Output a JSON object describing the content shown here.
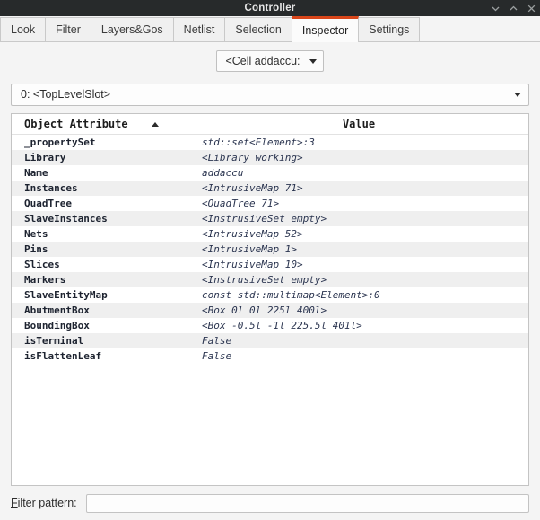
{
  "window": {
    "title": "Controller",
    "buttons": [
      {
        "name": "minimize",
        "icon": "chevron-down-icon"
      },
      {
        "name": "maximize",
        "icon": "chevron-up-icon"
      },
      {
        "name": "close",
        "icon": "close-icon"
      }
    ]
  },
  "colors": {
    "titlebar_bg": "#272a2b",
    "accent_orange": "#d9461a",
    "panel_bg": "#f4f4f4",
    "row_alt_bg": "#efefef",
    "table_bg": "#ffffff"
  },
  "tabs": [
    {
      "label": "Look",
      "active": false
    },
    {
      "label": "Filter",
      "active": false
    },
    {
      "label": "Layers&Gos",
      "active": false
    },
    {
      "label": "Netlist",
      "active": false
    },
    {
      "label": "Selection",
      "active": false
    },
    {
      "label": "Inspector",
      "active": true
    },
    {
      "label": "Settings",
      "active": false
    }
  ],
  "cell_selector": {
    "value": "<Cell addaccu:",
    "icon": "chevron-down-icon"
  },
  "slot_selector": {
    "value": "0: <TopLevelSlot>",
    "icon": "chevron-down-icon"
  },
  "table": {
    "columns": [
      "Object Attribute",
      "Value"
    ],
    "sort": {
      "column": "Object Attribute",
      "direction": "ascending",
      "icon": "sort-ascending-icon"
    },
    "rows": [
      {
        "attribute": "_propertySet",
        "value": "std::set<Element>:3"
      },
      {
        "attribute": "Library",
        "value": "<Library working>"
      },
      {
        "attribute": "Name",
        "value": "addaccu"
      },
      {
        "attribute": "Instances",
        "value": "<IntrusiveMap 71>"
      },
      {
        "attribute": "QuadTree",
        "value": "<QuadTree 71>"
      },
      {
        "attribute": "SlaveInstances",
        "value": "<InstrusiveSet empty>"
      },
      {
        "attribute": "Nets",
        "value": "<IntrusiveMap 52>"
      },
      {
        "attribute": "Pins",
        "value": "<IntrusiveMap 1>"
      },
      {
        "attribute": "Slices",
        "value": "<IntrusiveMap 10>"
      },
      {
        "attribute": "Markers",
        "value": "<InstrusiveSet empty>"
      },
      {
        "attribute": "SlaveEntityMap",
        "value": "const std::multimap<Element>:0"
      },
      {
        "attribute": "AbutmentBox",
        "value": "<Box 0l 0l 225l 400l>"
      },
      {
        "attribute": "BoundingBox",
        "value": "<Box -0.5l -1l 225.5l 401l>"
      },
      {
        "attribute": "isTerminal",
        "value": "False"
      },
      {
        "attribute": "isFlattenLeaf",
        "value": "False"
      }
    ]
  },
  "filter": {
    "label_mnemonic": "F",
    "label_rest": "ilter pattern:",
    "value": "",
    "placeholder": ""
  }
}
